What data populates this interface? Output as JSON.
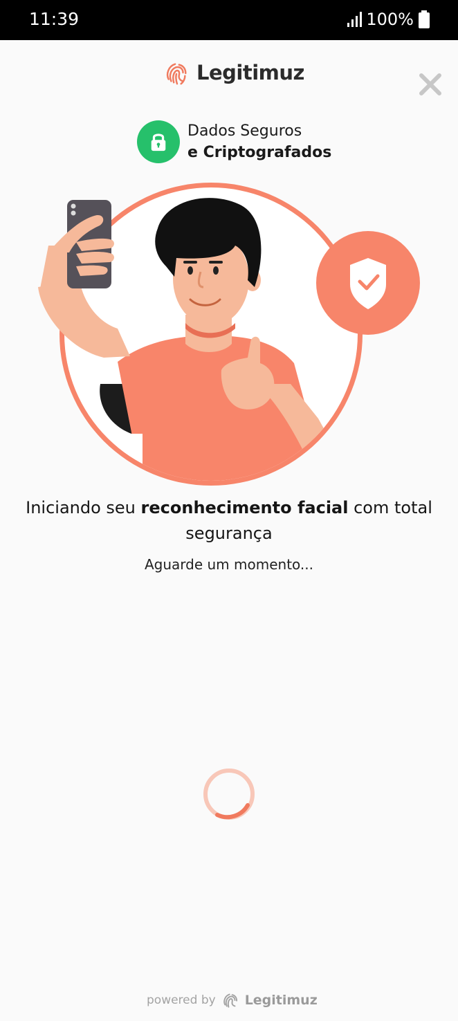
{
  "status_bar": {
    "time": "11:39",
    "battery": "100%",
    "icons": [
      "signal-icon",
      "battery-icon"
    ]
  },
  "header": {
    "brand_name": "Legitimuz",
    "brand_color": "#f07a5e",
    "close_icon": "close-icon"
  },
  "secure_badge": {
    "line1": "Dados Seguros",
    "line2": "e Criptografados",
    "icon": "lock-icon",
    "color": "#26c06b"
  },
  "illustration": {
    "accent_color": "#f7856a",
    "icons": [
      "shield-check-icon"
    ]
  },
  "message": {
    "prefix": "Iniciando seu ",
    "bold": "reconhecimento facial",
    "suffix": " com total segurança",
    "wait": "Aguarde um momento..."
  },
  "footer": {
    "powered_by": "powered by",
    "brand_name": "Legitimuz"
  }
}
